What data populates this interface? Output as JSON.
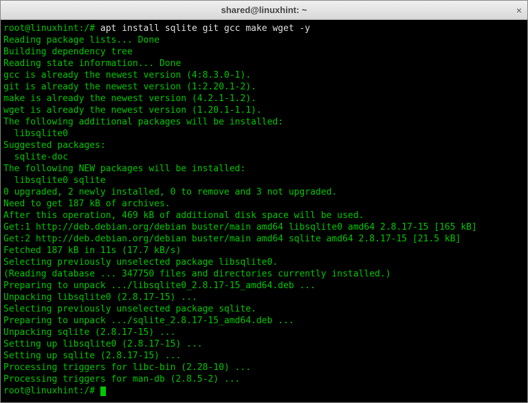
{
  "titlebar": {
    "title": "shared@linuxhint: ~",
    "close": "×"
  },
  "terminal": {
    "prompt1": "root@linuxhint:/# ",
    "command1": "apt install sqlite git gcc make wget -y",
    "lines": [
      "Reading package lists... Done",
      "Building dependency tree",
      "Reading state information... Done",
      "gcc is already the newest version (4:8.3.0-1).",
      "git is already the newest version (1:2.20.1-2).",
      "make is already the newest version (4.2.1-1.2).",
      "wget is already the newest version (1.20.1-1.1).",
      "The following additional packages will be installed:",
      "  libsqlite0",
      "Suggested packages:",
      "  sqlite-doc",
      "The following NEW packages will be installed:",
      "  libsqlite0 sqlite",
      "0 upgraded, 2 newly installed, 0 to remove and 3 not upgraded.",
      "Need to get 187 kB of archives.",
      "After this operation, 469 kB of additional disk space will be used.",
      "Get:1 http://deb.debian.org/debian buster/main amd64 libsqlite0 amd64 2.8.17-15 [165 kB]",
      "Get:2 http://deb.debian.org/debian buster/main amd64 sqlite amd64 2.8.17-15 [21.5 kB]",
      "Fetched 187 kB in 11s (17.7 kB/s)",
      "Selecting previously unselected package libsqlite0.",
      "(Reading database ... 347750 files and directories currently installed.)",
      "Preparing to unpack .../libsqlite0_2.8.17-15_amd64.deb ...",
      "Unpacking libsqlite0 (2.8.17-15) ...",
      "Selecting previously unselected package sqlite.",
      "Preparing to unpack .../sqlite_2.8.17-15_amd64.deb ...",
      "Unpacking sqlite (2.8.17-15) ...",
      "Setting up libsqlite0 (2.8.17-15) ...",
      "Setting up sqlite (2.8.17-15) ...",
      "Processing triggers for libc-bin (2.28-10) ...",
      "Processing triggers for man-db (2.8.5-2) ..."
    ],
    "prompt2": "root@linuxhint:/# "
  }
}
